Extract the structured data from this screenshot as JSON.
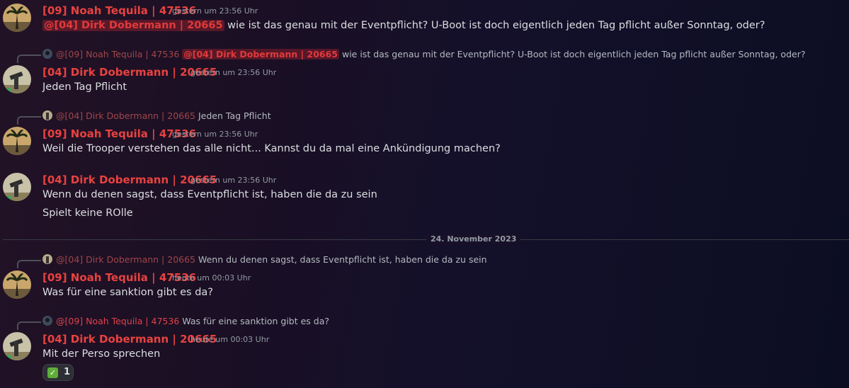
{
  "messages": [
    {
      "author": "[09] Noah Tequila | 47536",
      "timestamp": "gestern um 23:56 Uhr",
      "mention": "@[04] Dirk Dobermann | 20665",
      "text": " wie ist das genau mit der Eventpflicht? U-Boot ist doch eigentlich jeden Tag pflicht außer Sonntag, oder?"
    },
    {
      "reply_author": "@[09] Noah Tequila | 47536",
      "reply_mention": "@[04] Dirk Dobermann | 20665",
      "reply_text": " wie ist das genau mit der Eventpflicht? U-Boot ist doch eigentlich jeden Tag pflicht außer Sonntag, oder?",
      "author": "[04] Dirk Dobermann | 20665",
      "timestamp": "gestern um 23:56 Uhr",
      "text": "Jeden Tag Pflicht"
    },
    {
      "reply_author": "@[04] Dirk Dobermann | 20665",
      "reply_text": " Jeden Tag Pflicht",
      "author": "[09] Noah Tequila | 47536",
      "timestamp": "gestern um 23:56 Uhr",
      "text": "Weil die Trooper verstehen das alle nicht... Kannst du da mal eine Ankündigung machen?"
    },
    {
      "author": "[04] Dirk Dobermann | 20665",
      "timestamp": "gestern um 23:56 Uhr",
      "text": "Wenn du denen sagst, dass Eventpflicht ist, haben die da zu sein",
      "text2": "Spielt keine ROlle"
    },
    {
      "reply_author": "@[04] Dirk Dobermann | 20665",
      "reply_text": " Wenn du denen sagst, dass Eventpflicht ist, haben die da zu sein",
      "author": "[09] Noah Tequila | 47536",
      "timestamp": "heute um 00:03 Uhr",
      "text": "Was für eine sanktion gibt es da?"
    },
    {
      "reply_author": "@[09] Noah Tequila | 47536",
      "reply_text": " Was für eine sanktion gibt es da?",
      "author": "[04] Dirk Dobermann | 20665",
      "timestamp": "heute um 00:03 Uhr",
      "text": "Mit der Perso sprechen",
      "reaction": {
        "emoji": "white-check-mark",
        "count": "1"
      }
    }
  ],
  "date_divider": "24. November 2023",
  "colors": {
    "author_name": "#e8423f",
    "mention_bg": "rgba(201,40,48,0.35)",
    "text": "#dbdee1",
    "muted": "#949ba4"
  }
}
